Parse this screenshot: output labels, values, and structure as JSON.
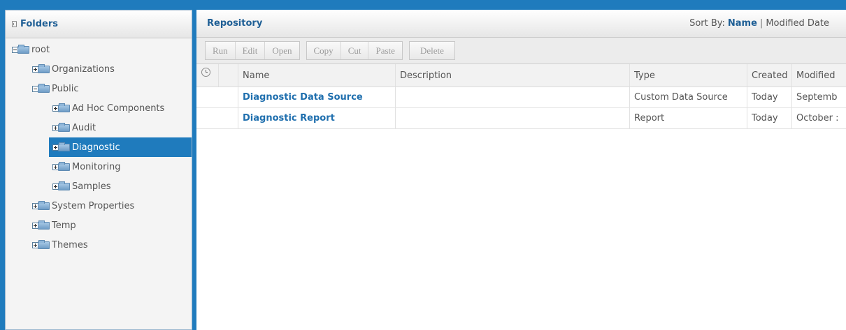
{
  "folders_panel": {
    "title": "Folders",
    "tree": [
      {
        "label": "root",
        "expanded": true,
        "level": 0
      },
      {
        "label": "Organizations",
        "expanded": false,
        "level": 1
      },
      {
        "label": "Public",
        "expanded": true,
        "level": 1
      },
      {
        "label": "Ad Hoc Components",
        "expanded": false,
        "level": 2
      },
      {
        "label": "Audit",
        "expanded": false,
        "level": 2
      },
      {
        "label": "Diagnostic",
        "expanded": false,
        "level": 2,
        "selected": true
      },
      {
        "label": "Monitoring",
        "expanded": false,
        "level": 2
      },
      {
        "label": "Samples",
        "expanded": false,
        "level": 2
      },
      {
        "label": "System Properties",
        "expanded": false,
        "level": 1
      },
      {
        "label": "Temp",
        "expanded": false,
        "level": 1
      },
      {
        "label": "Themes",
        "expanded": false,
        "level": 1
      }
    ]
  },
  "repository": {
    "title": "Repository",
    "sort": {
      "label": "Sort By:",
      "active": "Name",
      "separator": "|",
      "other": "Modified Date"
    },
    "toolbar": {
      "run": "Run",
      "edit": "Edit",
      "open": "Open",
      "copy": "Copy",
      "cut": "Cut",
      "paste": "Paste",
      "delete": "Delete"
    },
    "columns": {
      "name": "Name",
      "description": "Description",
      "type": "Type",
      "created": "Created",
      "modified": "Modified"
    },
    "rows": [
      {
        "name": "Diagnostic Data Source",
        "description": "",
        "type": "Custom Data Source",
        "created": "Today",
        "modified": "Septemb"
      },
      {
        "name": "Diagnostic Report",
        "description": "",
        "type": "Report",
        "created": "Today",
        "modified": "October :"
      }
    ]
  },
  "colors": {
    "accent": "#1f7bbd",
    "link": "#1f6fae",
    "header_text": "#1f5f95"
  }
}
